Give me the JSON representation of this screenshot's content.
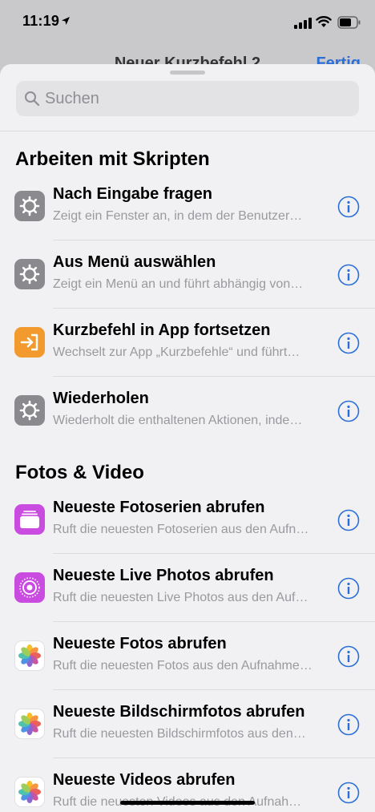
{
  "status_bar": {
    "time": "11:19"
  },
  "background_nav": {
    "title": "Neuer Kurzbefehl 2",
    "done_label": "Fertig"
  },
  "search": {
    "placeholder": "Suchen"
  },
  "sections": [
    {
      "title": "Arbeiten mit Skripten",
      "items": [
        {
          "title": "Nach Eingabe fragen",
          "subtitle": "Zeigt ein Fenster an, in dem der Benutzer…",
          "icon": "gear-icon"
        },
        {
          "title": "Aus Menü auswählen",
          "subtitle": "Zeigt ein Menü an und führt abhängig von…",
          "icon": "gear-icon"
        },
        {
          "title": "Kurzbefehl in App fortsetzen",
          "subtitle": "Wechselt zur App „Kurzbefehle“ und führt…",
          "icon": "continue-in-app-icon"
        },
        {
          "title": "Wiederholen",
          "subtitle": "Wiederholt die enthaltenen Aktionen, inde…",
          "icon": "gear-icon"
        }
      ]
    },
    {
      "title": "Fotos & Video",
      "items": [
        {
          "title": "Neueste Fotoserien abrufen",
          "subtitle": "Ruft die neuesten Fotoserien aus den Aufn…",
          "icon": "burst-photos-icon"
        },
        {
          "title": "Neueste Live Photos abrufen",
          "subtitle": "Ruft die neuesten Live Photos aus den Auf…",
          "icon": "live-photos-icon"
        },
        {
          "title": "Neueste Fotos abrufen",
          "subtitle": "Ruft die neuesten Fotos aus den Aufnahme…",
          "icon": "photos-app-icon"
        },
        {
          "title": "Neueste Bildschirmfotos abrufen",
          "subtitle": "Ruft die neuesten Bildschirmfotos aus den…",
          "icon": "photos-app-icon"
        },
        {
          "title": "Neueste Videos abrufen",
          "subtitle": "Ruft die neuesten Videos aus den Aufnah…",
          "icon": "photos-app-icon"
        }
      ]
    }
  ],
  "colors": {
    "accent": "#2b6fd6",
    "gear_icon_bg": "#8a8a8e",
    "app_icon_orange": "#f39a2e",
    "photos_purple": "#c94be0"
  }
}
